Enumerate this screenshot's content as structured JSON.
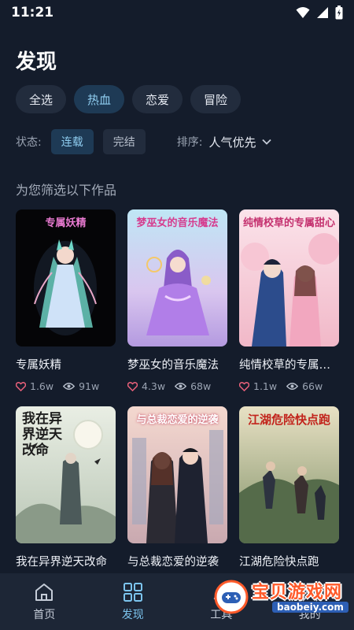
{
  "status_bar": {
    "time": "11:21"
  },
  "page": {
    "title": "发现"
  },
  "genres": [
    {
      "label": "全选",
      "active": false
    },
    {
      "label": "热血",
      "active": true
    },
    {
      "label": "恋爱",
      "active": false
    },
    {
      "label": "冒险",
      "active": false
    }
  ],
  "filters": {
    "status_label": "状态:",
    "status_options": [
      "连载",
      "完结"
    ],
    "status_selected": "连载",
    "sort_label": "排序:",
    "sort_value": "人气优先"
  },
  "section_title": "为您筛选以下作品",
  "books": [
    {
      "title": "专属妖精",
      "likes": "1.6w",
      "views": "91w",
      "cover_text": "专属妖精"
    },
    {
      "title": "梦巫女的音乐魔法",
      "likes": "4.3w",
      "views": "68w",
      "cover_text": "梦巫女的音乐魔法"
    },
    {
      "title": "纯情校草的专属甜心",
      "likes": "1.1w",
      "views": "66w",
      "cover_text": "纯情校草的专属甜心"
    },
    {
      "title": "我在异界逆天改命",
      "cover_text": "我在异界逆天改命"
    },
    {
      "title": "与总裁恋爱的逆袭",
      "cover_text": "与总裁恋爱的逆袭"
    },
    {
      "title": "江湖危险快点跑",
      "cover_text": "江湖危险快点跑"
    }
  ],
  "bottom_nav": [
    {
      "label": "首页",
      "icon": "home-icon"
    },
    {
      "label": "发现",
      "icon": "discover-grid-icon",
      "active": true
    },
    {
      "label": "工具",
      "icon": "tools-icon"
    },
    {
      "label": "我的",
      "icon": "profile-icon"
    }
  ],
  "watermark": {
    "text": "宝贝游戏网",
    "domain": "baobeiy.com"
  },
  "colors": {
    "background": "#141c2b",
    "accent": "#7cc4ee",
    "chip_bg": "#222c3d",
    "chip_active_bg": "#1e3a55"
  }
}
